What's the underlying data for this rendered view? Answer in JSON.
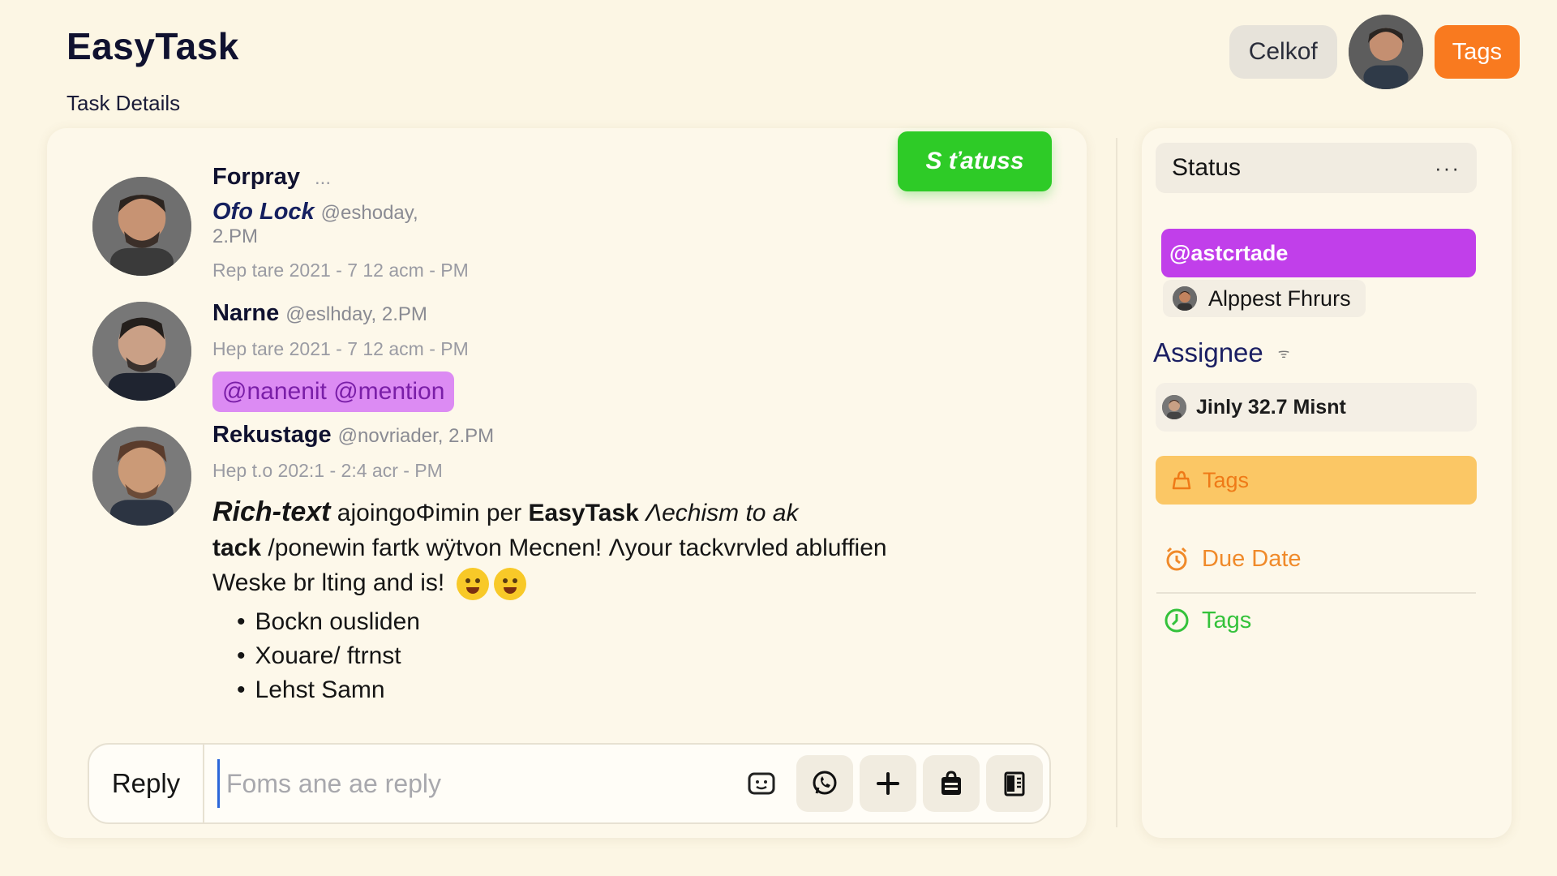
{
  "app": {
    "title": "EasyTask",
    "subtitle": "Task Details"
  },
  "topbar": {
    "user_pill": "Celkof",
    "tags_button": "Tags"
  },
  "status_button": "S ťatuss",
  "messages": [
    {
      "name": "Forpray",
      "title": "Ofo Lock",
      "handle": "@eshoday, 2.PM",
      "meta": "Rep tare 2021 - 7 12 acm - PM"
    },
    {
      "name": "Narne",
      "handle": "@eslhday, 2.PM",
      "meta": "Hep tare 2021 - 7 12 acm - PM",
      "mention": "@nanenit @mention"
    },
    {
      "name": "Rekustage",
      "handle": "@novriader, 2.PM",
      "meta": "Hep t.o 202:1 - 2:4 acr - PM",
      "rich": {
        "p1": "Rich-text",
        "p2": " ajoingoΦimin per ",
        "p3": "EasyTask",
        "p4": " Λechism to ak",
        "p5": "tack",
        "p6": " /ponewin fartk wÿtvon Mecnen! Λyour tackvrvled abluffien",
        "p7": "Weske br lting and is!",
        "bullets": [
          "Bockn ousliden",
          "Xouare/ ftrnst",
          "Lehst Samn"
        ]
      }
    }
  ],
  "reply": {
    "label": "Reply",
    "placeholder": "Foms ane ae reply"
  },
  "toolbar_icons": [
    "emoji-icon",
    "whatsapp-icon",
    "plus-icon",
    "bag-icon",
    "book-icon"
  ],
  "sidebar": {
    "status_title": "Status",
    "status_more": "···",
    "purple_bar": "@astcrtade",
    "chip": "Alppest Fhrurs",
    "assignee_title": "Assignee",
    "assignee_row": "Jinly 32.7 Misnt",
    "tags_orange": "Tags",
    "due_date": "Due Date",
    "tags_green": "Tags"
  },
  "colors": {
    "accent_green": "#2ecb27",
    "accent_orange": "#f97a1f",
    "accent_purple": "#c13fea",
    "mention_bg": "#dc8bf3",
    "tag_orange_bg": "#fbc765"
  }
}
